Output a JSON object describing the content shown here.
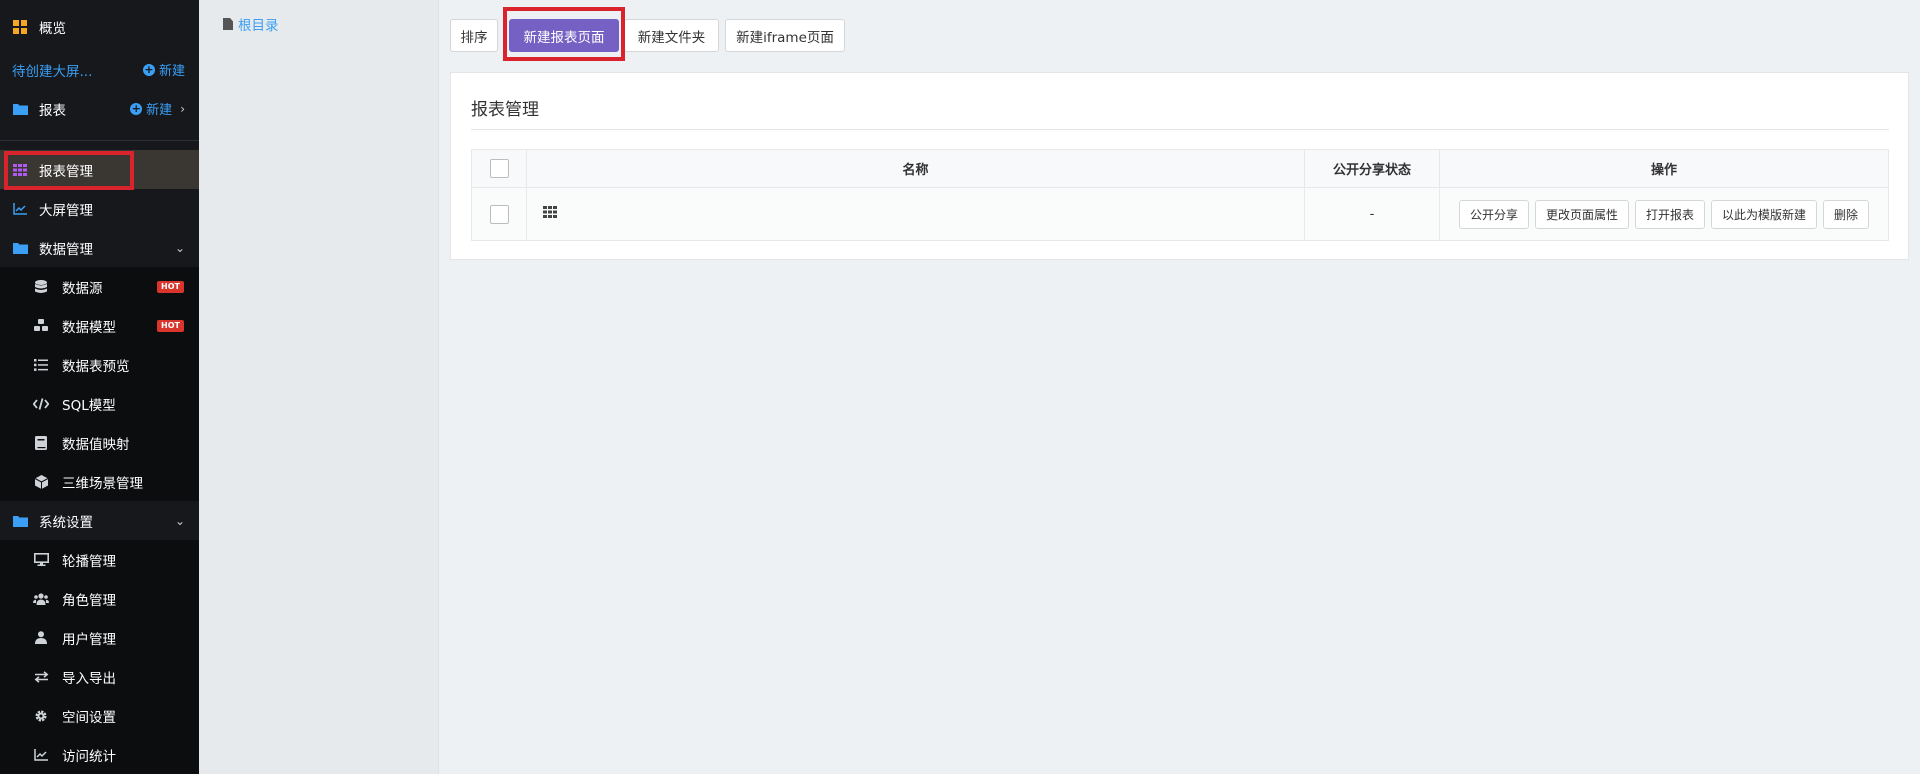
{
  "sidebar": {
    "overview": "概览",
    "pending": "待创建大屏...",
    "new_label": "新建",
    "reports": "报表",
    "report_mgmt": "报表管理",
    "screen_mgmt": "大屏管理",
    "data_mgmt": "数据管理",
    "datasource": "数据源",
    "data_model": "数据模型",
    "table_preview": "数据表预览",
    "sql_model": "SQL模型",
    "value_map": "数据值映射",
    "scene3d": "三维场景管理",
    "system": "系统设置",
    "carousel": "轮播管理",
    "role": "角色管理",
    "user": "用户管理",
    "import_export": "导入导出",
    "space": "空间设置",
    "stats": "访问统计",
    "hot": "HOT"
  },
  "tree": {
    "root": "根目录"
  },
  "toolbar": {
    "sort": "排序",
    "new_report_page": "新建报表页面",
    "new_folder": "新建文件夹",
    "new_iframe": "新建iframe页面"
  },
  "card": {
    "title": "报表管理",
    "columns": {
      "name": "名称",
      "share_status": "公开分享状态",
      "actions": "操作"
    },
    "rows": [
      {
        "name": "",
        "share_status": "-"
      }
    ],
    "actions": {
      "public_share": "公开分享",
      "edit_props": "更改页面属性",
      "open_report": "打开报表",
      "new_from_template": "以此为模版新建",
      "delete": "删除"
    }
  },
  "colors": {
    "accent": "#7561c4",
    "link": "#3a9ff5",
    "highlight": "#d9232d",
    "sidebar_bg": "#16181c"
  }
}
